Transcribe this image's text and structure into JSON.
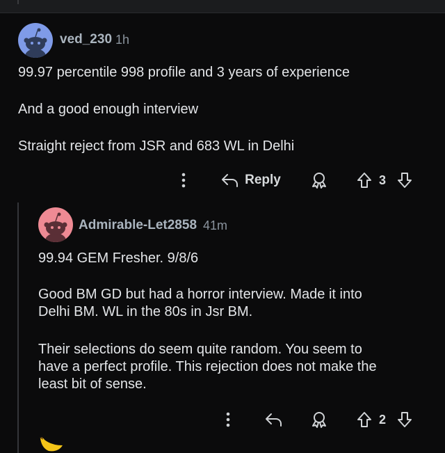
{
  "comments": [
    {
      "username": "ved_230",
      "time": "1h",
      "body": [
        "99.97 percentile 998 profile and 3 years of experience",
        "And a good enough interview",
        "Straight reject from JSR and 683 WL in Delhi"
      ],
      "actions": {
        "reply_label": "Reply",
        "vote_count": "3"
      }
    },
    {
      "username": "Admirable-Let2858",
      "time": "41m",
      "body": [
        "99.94 GEM Fresher. 9/8/6",
        "Good BM GD but had a horror interview. Made it into\nDelhi BM. WL in the 80s in Jsr BM.",
        "Their selections do seem quite random. You seem to\nhave a perfect profile. This rejection does not make the\nleast bit of sense."
      ],
      "actions": {
        "vote_count": "2"
      }
    }
  ],
  "colors": {
    "background": "#0b0b0c",
    "username": "#aab4be",
    "avatar_blue": "#7f9be8",
    "avatar_pink": "#ee8a94"
  },
  "icons": [
    "snoo-avatar-icon",
    "more-options-icon",
    "reply-arrow-icon",
    "award-icon",
    "upvote-icon",
    "downvote-icon",
    "banana-emoji-icon"
  ]
}
